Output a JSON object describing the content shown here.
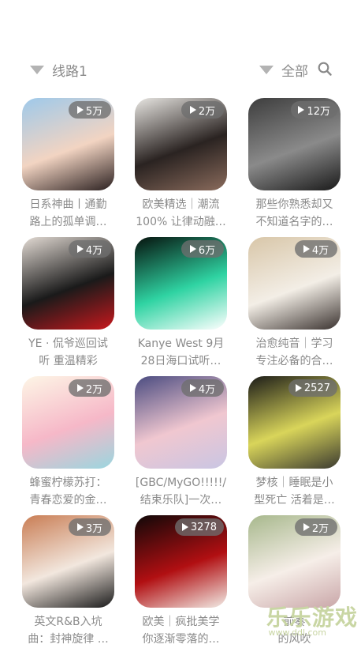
{
  "filters": {
    "route_label": "线路1",
    "category_label": "全部"
  },
  "items": [
    {
      "count": "5万",
      "title1": "日系神曲丨通勤",
      "title2": "路上的孤单调…",
      "colors": [
        "#9ec9ea",
        "#f2d4c2",
        "#2b2020"
      ]
    },
    {
      "count": "2万",
      "title1": "欧美精选｜潮流",
      "title2": "100% 让律动融…",
      "colors": [
        "#e8e6e2",
        "#2a2321",
        "#8a6b5c"
      ]
    },
    {
      "count": "12万",
      "title1": "那些你熟悉却又",
      "title2": "不知道名字的…",
      "colors": [
        "#3d3d3d",
        "#8a8a8a",
        "#1a1a1a"
      ]
    },
    {
      "count": "4万",
      "title1": "YE · 侃爷巡回试",
      "title2": "听 重温精彩",
      "colors": [
        "#e3dbd4",
        "#1a1a1a",
        "#c9181d"
      ]
    },
    {
      "count": "6万",
      "title1": "Kanye West 9月",
      "title2": "28日海口试听…",
      "colors": [
        "#06120d",
        "#2fd3a2",
        "#ffffff"
      ]
    },
    {
      "count": "4万",
      "title1": "治愈纯音｜学习",
      "title2": "专注必备的合…",
      "colors": [
        "#d8c6a8",
        "#f3eee6",
        "#3b3330"
      ]
    },
    {
      "count": "2万",
      "title1": "蜂蜜柠檬苏打：",
      "title2": "青春恋爱的金…",
      "colors": [
        "#fdf6e6",
        "#f6b8c8",
        "#9ad6df"
      ]
    },
    {
      "count": "4万",
      "title1": "[GBC/MyGO!!!!!/",
      "title2": "结束乐队]一次…",
      "colors": [
        "#4a4b80",
        "#f0c7d0",
        "#c9c6e3"
      ]
    },
    {
      "count": "2527",
      "title1": "梦核｜睡眠是小",
      "title2": "型死亡 活着是…",
      "colors": [
        "#1b1b18",
        "#d9d55a",
        "#3b3a30"
      ]
    },
    {
      "count": "3万",
      "title1": "英文R&B入坑",
      "title2": "曲：封神旋律 …",
      "colors": [
        "#c97d54",
        "#f2e7de",
        "#1a1a1a"
      ]
    },
    {
      "count": "3278",
      "title1": "欧美｜疯批美学",
      "title2": "你逐渐零落的…",
      "colors": [
        "#0f0808",
        "#b10f12",
        "#f2ece6"
      ]
    },
    {
      "count": "2万",
      "title1": "前奏",
      "title2": "的风吹",
      "colors": [
        "#a7b88c",
        "#f6eee8",
        "#c9a6a8"
      ]
    }
  ],
  "watermark": {
    "text": "乐乐游戏",
    "url": "www.ddl.com"
  },
  "icons": {
    "search": "search-icon",
    "play": "play-icon",
    "dropdown": "triangle-down-icon"
  }
}
